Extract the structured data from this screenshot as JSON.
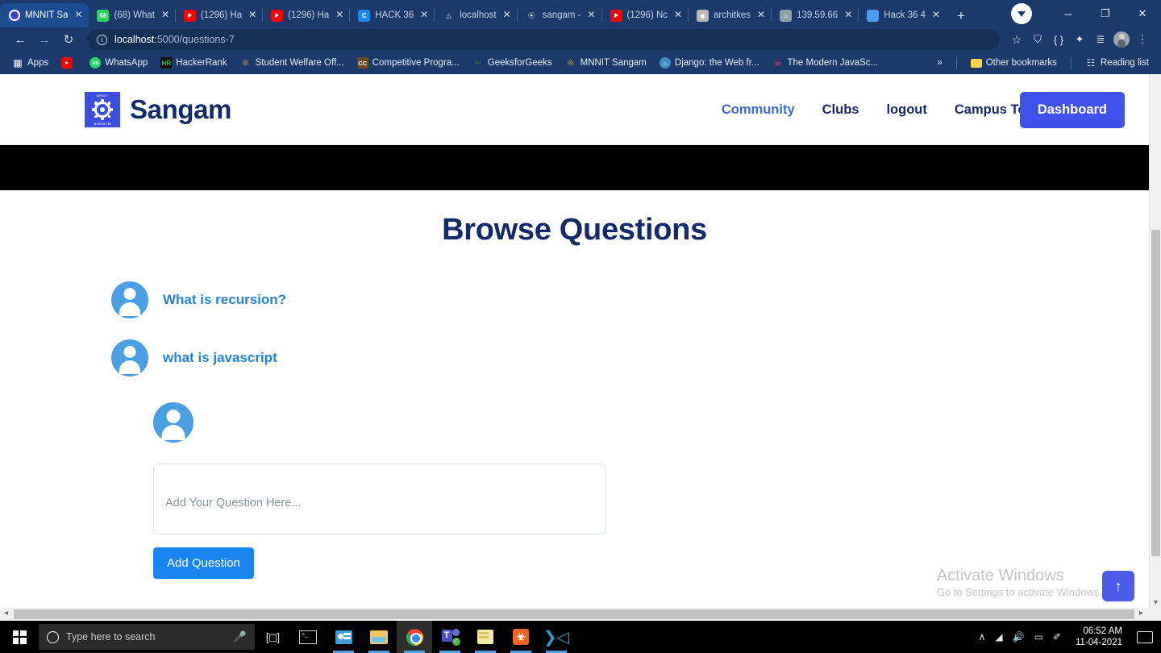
{
  "browser": {
    "tabs": [
      {
        "title": "MNNIT Sa",
        "icon": "mnnit-favicon",
        "active": true
      },
      {
        "title": "(68) What",
        "icon": "whatsapp-favicon",
        "active": false
      },
      {
        "title": "(1296) Ha",
        "icon": "youtube-favicon",
        "active": false
      },
      {
        "title": "(1296) Ha",
        "icon": "youtube-favicon",
        "active": false
      },
      {
        "title": "HACK 36",
        "icon": "hack36-favicon",
        "active": false
      },
      {
        "title": "localhost",
        "icon": "flask-favicon",
        "active": false
      },
      {
        "title": "sangam -",
        "icon": "sangam-favicon",
        "active": false
      },
      {
        "title": "(1296) Nc",
        "icon": "youtube-favicon",
        "active": false
      },
      {
        "title": "architkes",
        "icon": "github-favicon",
        "active": false
      },
      {
        "title": "139.59.66",
        "icon": "globe-favicon",
        "active": false
      },
      {
        "title": "Hack 36 4",
        "icon": "docs-favicon",
        "active": false
      }
    ],
    "new_tab_label": "+",
    "tab_close_label": "✕",
    "window_controls": {
      "minimize": "─",
      "maximize": "❐",
      "close": "✕"
    },
    "toolbar": {
      "back_label": "←",
      "forward_label": "→",
      "reload_label": "↻",
      "info_label": "i",
      "url_host": "localhost",
      "url_path": ":5000/questions-7",
      "star_label": "☆",
      "shield_label": "⛉",
      "code_label": "{ }",
      "extensions_label": "✦",
      "readinglist_label": "≣",
      "menu_label": "⋮"
    },
    "bookmarks": [
      {
        "label": "Apps",
        "icon": "apps-grid-icon"
      },
      {
        "label": "",
        "icon": "youtube-icon"
      },
      {
        "label": "WhatsApp",
        "icon": "whatsapp-icon"
      },
      {
        "label": "HackerRank",
        "icon": "hackerrank-icon"
      },
      {
        "label": "Student Welfare Off...",
        "icon": "emblem-icon"
      },
      {
        "label": "Competitive Progra...",
        "icon": "cc-icon"
      },
      {
        "label": "GeeksforGeeks",
        "icon": "gfg-icon"
      },
      {
        "label": "MNNIT Sangam",
        "icon": "emblem-icon"
      },
      {
        "label": "Django: the Web fr...",
        "icon": "globe-icon"
      },
      {
        "label": "The Modern JavaSc...",
        "icon": "js-icon"
      }
    ],
    "bookmarks_overflow_label": "»",
    "other_bookmarks_label": "Other bookmarks",
    "reading_list_label": "Reading list"
  },
  "site": {
    "brand_name": "Sangam",
    "logo_top_text": "MNNIT",
    "logo_bottom_text": "SANGAM",
    "nav": [
      {
        "label": "Community",
        "style": "accent"
      },
      {
        "label": "Clubs",
        "style": "dark"
      },
      {
        "label": "logout",
        "style": "dark"
      },
      {
        "label": "Campus Tour",
        "style": "dark"
      }
    ],
    "dashboard_button": "Dashboard"
  },
  "main": {
    "page_title": "Browse Questions",
    "questions": [
      {
        "text": "What is recursion?"
      },
      {
        "text": "what is javascript"
      }
    ],
    "composer": {
      "placeholder": "Add Your Question Here...",
      "submit_label": "Add Question"
    },
    "scroll_top_label": "↑"
  },
  "watermark": {
    "line1": "Activate Windows",
    "line2": "Go to Settings to activate Windows."
  },
  "taskbar": {
    "search_placeholder": "Type here to search",
    "apps": [
      {
        "name": "task-view",
        "icon": "taskview-icon"
      },
      {
        "name": "terminal",
        "icon": "terminal-icon"
      },
      {
        "name": "contacts",
        "icon": "contacts-icon"
      },
      {
        "name": "file-explorer",
        "icon": "folder-icon"
      },
      {
        "name": "chrome",
        "icon": "chrome-icon"
      },
      {
        "name": "teams",
        "icon": "teams-icon"
      },
      {
        "name": "sticky-notes",
        "icon": "notes-icon"
      },
      {
        "name": "xampp",
        "icon": "xampp-icon"
      },
      {
        "name": "vs-code",
        "icon": "vscode-icon"
      }
    ],
    "tray": {
      "chevron": "∧",
      "wifi": "◢",
      "volume": "🔊",
      "battery": "▭",
      "pen": "✐"
    },
    "time": "06:52 AM",
    "date": "11-04-2021"
  }
}
